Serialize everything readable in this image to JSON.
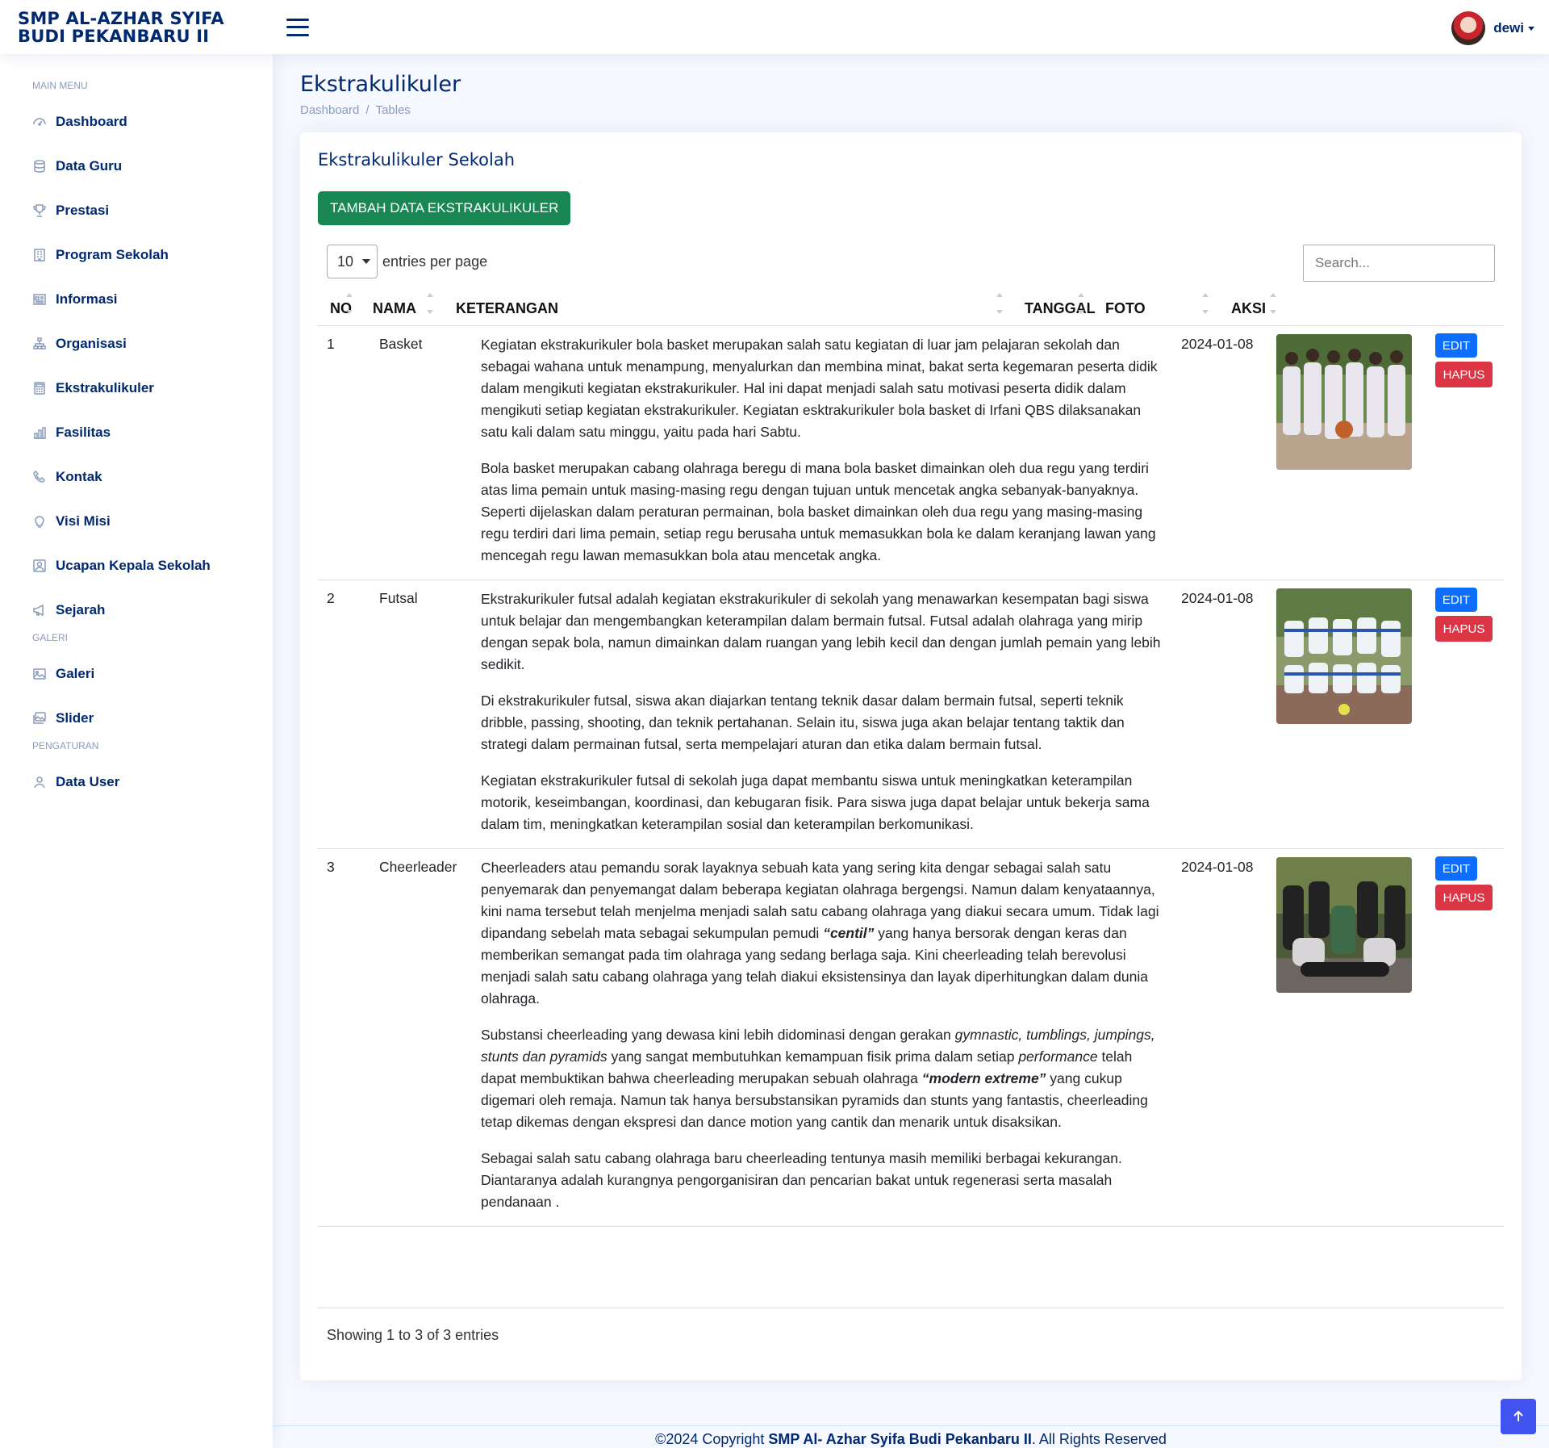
{
  "header": {
    "brand": "SMP AL-AZHAR SYIFA BUDI PEKANBARU II",
    "user_name": "dewi"
  },
  "sidebar": {
    "main_heading": "MAIN MENU",
    "main_items": [
      {
        "label": "Dashboard",
        "icon": "dashboard-icon"
      },
      {
        "label": "Data Guru",
        "icon": "database-icon"
      },
      {
        "label": "Prestasi",
        "icon": "trophy-icon"
      },
      {
        "label": "Program Sekolah",
        "icon": "building-icon"
      },
      {
        "label": "Informasi",
        "icon": "newspaper-icon"
      },
      {
        "label": "Organisasi",
        "icon": "diagram-icon"
      },
      {
        "label": "Ekstrakulikuler",
        "icon": "calculator-icon"
      },
      {
        "label": "Fasilitas",
        "icon": "bar-chart-icon"
      },
      {
        "label": "Kontak",
        "icon": "phone-icon"
      },
      {
        "label": "Visi Misi",
        "icon": "lightbulb-icon"
      },
      {
        "label": "Ucapan Kepala Sekolah",
        "icon": "person-square-icon"
      },
      {
        "label": "Sejarah",
        "icon": "megaphone-icon"
      }
    ],
    "gallery_heading": "GALERI",
    "gallery_items": [
      {
        "label": "Galeri",
        "icon": "image-icon"
      },
      {
        "label": "Slider",
        "icon": "images-icon"
      }
    ],
    "settings_heading": "PENGATURAN",
    "settings_items": [
      {
        "label": "Data User",
        "icon": "person-icon"
      }
    ]
  },
  "page": {
    "title": "Ekstrakulikuler",
    "breadcrumb": [
      "Dashboard",
      "Tables"
    ]
  },
  "card": {
    "title": "Ekstrakulikuler Sekolah",
    "add_button": "TAMBAH DATA EKSTRAKULIKULER",
    "entries_value": "10",
    "entries_label": "entries per page",
    "search_placeholder": "Search...",
    "showing": "Showing 1 to 3 of 3 entries"
  },
  "table": {
    "columns": [
      "NO",
      "NAMA",
      "KETERANGAN",
      "TANGGAL",
      "FOTO",
      "AKSI"
    ],
    "edit_label": "EDIT",
    "delete_label": "HAPUS",
    "rows": [
      {
        "no": "1",
        "nama": "Basket",
        "tanggal": "2024-01-08",
        "paragraphs": [
          "Kegiatan ekstrakurikuler bola basket merupakan salah satu kegiatan di luar jam pelajaran sekolah dan sebagai wahana untuk menampung, menyalurkan dan membina minat, bakat serta kegemaran peserta didik dalam mengikuti kegiatan ekstrakurikuler. Hal ini dapat menjadi salah satu motivasi peserta didik dalam mengikuti setiap kegiatan ekstrakurikuler. Kegiatan esktrakurikuler bola basket di Irfani QBS dilaksanakan satu kali dalam satu minggu, yaitu pada hari Sabtu.",
          "Bola basket merupakan cabang olahraga beregu di mana bola basket dimainkan oleh dua regu yang terdiri atas lima pemain untuk masing-masing regu dengan tujuan untuk mencetak angka sebanyak-banyaknya. Seperti dijelaskan dalam peraturan permainan, bola basket dimainkan oleh dua regu yang masing-masing regu terdiri dari lima pemain, setiap regu berusaha untuk memasukkan bola ke dalam keranjang lawan yang mencegah regu lawan memasukkan bola atau mencetak angka."
        ]
      },
      {
        "no": "2",
        "nama": "Futsal",
        "tanggal": "2024-01-08",
        "paragraphs": [
          "Ekstrakurikuler futsal adalah kegiatan ekstrakurikuler di sekolah yang menawarkan kesempatan bagi siswa untuk belajar dan mengembangkan keterampilan dalam bermain futsal. Futsal adalah olahraga yang mirip dengan sepak bola, namun dimainkan dalam ruangan yang lebih kecil dan dengan jumlah pemain yang lebih sedikit.",
          "Di ekstrakurikuler futsal, siswa akan diajarkan tentang teknik dasar dalam bermain futsal, seperti teknik dribble, passing, shooting, dan teknik pertahanan. Selain itu, siswa juga akan belajar tentang taktik dan strategi dalam permainan futsal, serta mempelajari aturan dan etika dalam bermain futsal.",
          "Kegiatan ekstrakurikuler futsal di sekolah juga dapat membantu siswa untuk meningkatkan keterampilan motorik, keseimbangan, koordinasi, dan kebugaran fisik. Para siswa juga dapat belajar untuk bekerja sama dalam tim, meningkatkan keterampilan sosial dan keterampilan berkomunikasi."
        ]
      },
      {
        "no": "3",
        "nama": "Cheerleader",
        "tanggal": "2024-01-08",
        "p1_a": "Cheerleaders atau pemandu sorak layaknya sebuah kata yang sering kita dengar sebagai salah satu penyemarak dan penyemangat dalam beberapa kegiatan olahraga bergengsi. Namun dalam kenyataannya, kini nama tersebut telah menjelma menjadi salah satu cabang olahraga yang diakui secara umum. Tidak lagi dipandang sebelah mata sebagai sekumpulan pemudi ",
        "p1_b": "“centil”",
        "p1_c": " yang hanya bersorak dengan keras dan memberikan semangat pada tim olahraga yang sedang berlaga saja. Kini cheerleading  telah berevolusi menjadi salah satu cabang olahraga yang telah diakui eksistensinya dan layak diperhitungkan dalam dunia olahraga.",
        "p2_a": "Substansi cheerleading yang dewasa kini lebih didominasi dengan gerakan ",
        "p2_b": "gymnastic, tumblings, jumpings, stunts dan pyramids",
        "p2_c": " yang sangat membutuhkan kemampuan fisik prima dalam setiap ",
        "p2_d": "performance",
        "p2_e": " telah dapat membuktikan bahwa cheerleading merupakan sebuah olahraga ",
        "p2_f": "“modern extreme”",
        "p2_g": " yang cukup digemari oleh remaja. Namun tak hanya bersubstansikan pyramids dan stunts yang fantastis, cheerleading tetap dikemas dengan ekspresi dan dance motion yang cantik dan menarik untuk disaksikan.",
        "p3": "Sebagai salah satu cabang olahraga baru cheerleading tentunya masih memiliki berbagai kekurangan. Diantaranya adalah kurangnya pengorganisiran dan pencarian bakat untuk regenerasi serta masalah pendanaan ."
      }
    ]
  },
  "footer": {
    "prefix": "©2024 Copyright ",
    "name": "SMP Al- Azhar Syifa Budi Pekanbaru II",
    "suffix": ". All Rights Reserved"
  },
  "colors": {
    "brand": "#012970",
    "add_button": "#198754",
    "edit_button": "#0d6efd",
    "delete_button": "#dc3545",
    "back_to_top": "#4154f1"
  }
}
